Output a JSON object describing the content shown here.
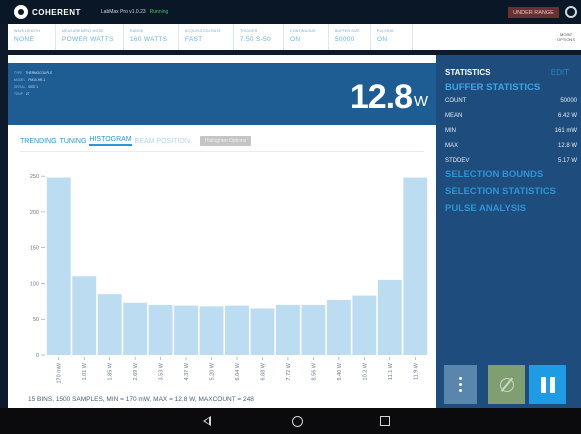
{
  "app": {
    "brand": "COHERENT",
    "title": "LabMax Pro v1.0.23",
    "status": "Running",
    "range_badge": "UNDER RANGE"
  },
  "settings": [
    {
      "label": "Wavelength",
      "value": "NONE"
    },
    {
      "label": "Measurement Mode",
      "value": "POWER WATTS"
    },
    {
      "label": "Range",
      "value": "160 WATTS"
    },
    {
      "label": "Acquisition Rate",
      "value": "FAST"
    },
    {
      "label": "Trigger",
      "value": "7.50 S-50"
    },
    {
      "label": "Continuous",
      "value": "ON"
    },
    {
      "label": "Buffer Size",
      "value": "50000"
    },
    {
      "label": "Pulsing",
      "value": "ON"
    }
  ],
  "more_options": {
    "line1": "MORE",
    "line2": "OPTIONS"
  },
  "sensor_info": [
    {
      "k": "TYPE",
      "v": "THERMOCOUPLE"
    },
    {
      "k": "MODEL",
      "v": "PM10-HR-1"
    },
    {
      "k": "SERIAL",
      "v": "0037 1"
    },
    {
      "k": "TEMP",
      "v": "27"
    }
  ],
  "readout": {
    "value": "12.8",
    "unit": "W"
  },
  "tabs": [
    {
      "label": "TRENDING",
      "state": "normal"
    },
    {
      "label": "TUNING",
      "state": "normal"
    },
    {
      "label": "HISTOGRAM",
      "state": "active"
    },
    {
      "label": "BEAM POSITION",
      "state": "disabled"
    }
  ],
  "histogram_button": "Histogram Options",
  "chart_data": {
    "type": "bar",
    "categories": [
      "170 mW",
      "1.01 W",
      "1.85 W",
      "2.69 W",
      "3.53 W",
      "4.37 W",
      "5.20 W",
      "6.04 W",
      "6.88 W",
      "7.72 W",
      "8.56 W",
      "9.40 W",
      "10.2 W",
      "11.1 W",
      "11.9 W"
    ],
    "values": [
      248,
      110,
      85,
      73,
      70,
      69,
      68,
      69,
      65,
      70,
      70,
      77,
      83,
      105,
      248
    ],
    "ylim": [
      0,
      260
    ],
    "yticks": [
      0,
      50,
      100,
      150,
      200,
      250
    ],
    "grid": false,
    "bar_color": "#bcdcf2",
    "caption": "15 BINS, 1500 SAMPLES, MIN = 170 mW, MAX = 12.8 W, MAXCOUNT = 248"
  },
  "stats": {
    "title": "STATISTICS",
    "edit": "EDIT",
    "buffer_heading": "BUFFER STATISTICS",
    "rows": [
      {
        "label": "COUNT",
        "value": "50000"
      },
      {
        "label": "MEAN",
        "value": "6.42 W"
      },
      {
        "label": "MIN",
        "value": "161 mW"
      },
      {
        "label": "MAX",
        "value": "12.8 W"
      },
      {
        "label": "STDDEV",
        "value": "5.17 W"
      }
    ],
    "sections": [
      "SELECTION BOUNDS",
      "SELECTION STATISTICS",
      "PULSE ANALYSIS"
    ]
  },
  "colors": {
    "accent": "#2f95d3",
    "panel": "#1e4c7c",
    "readout": "#1d5d94",
    "zero_button": "#7f9e72",
    "pause_button": "#1d9be4"
  }
}
